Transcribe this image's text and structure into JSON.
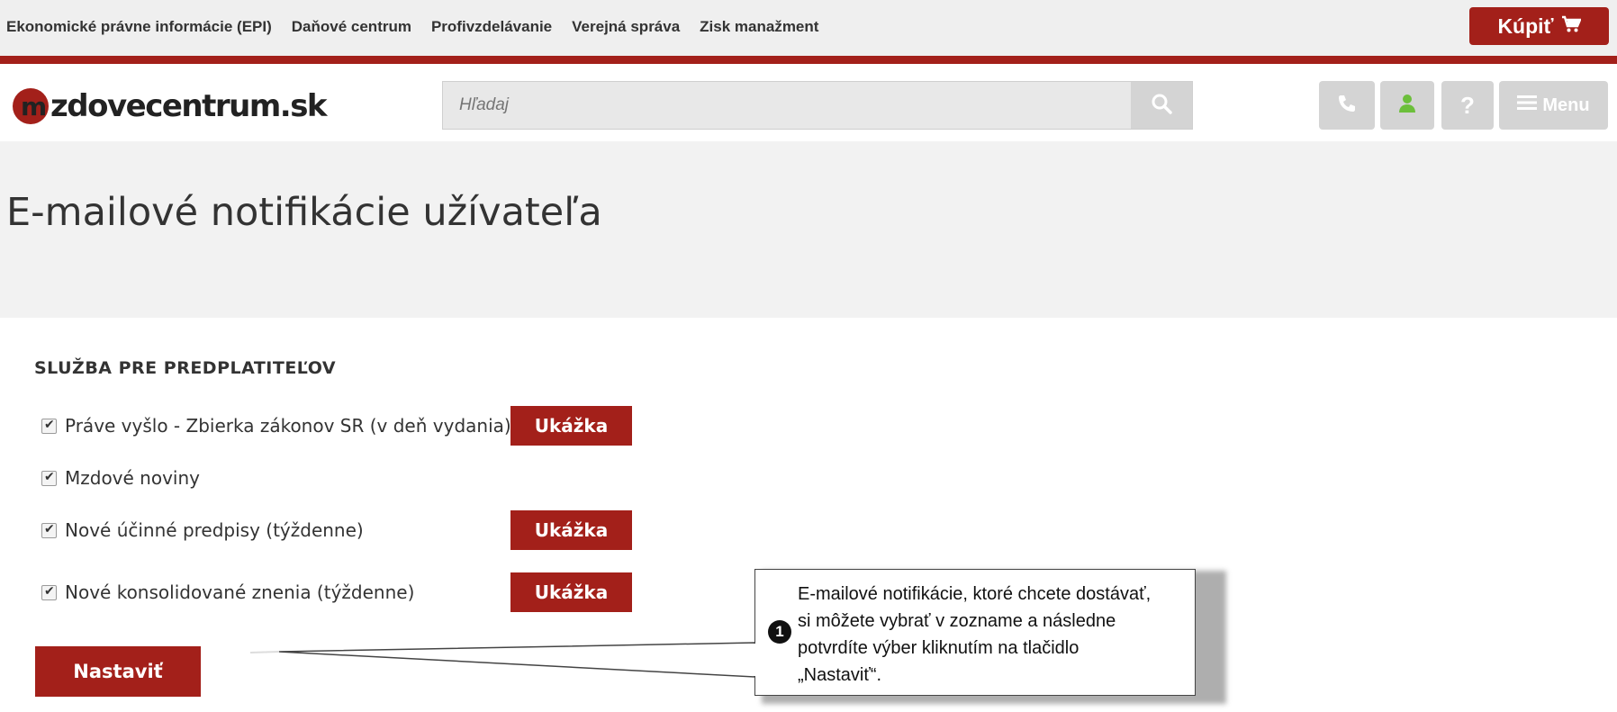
{
  "topnav": {
    "links": [
      "Ekonomické právne informácie (EPI)",
      "Daňové centrum",
      "Profivzdelávanie",
      "Verejná správa",
      "Zisk manažment"
    ],
    "buy_label": "Kúpiť",
    "accent_color": "#a3201a"
  },
  "header": {
    "logo_letter": "m",
    "logo_text": "zdovecentrum.sk",
    "search_placeholder": "Hľadaj",
    "menu_label": "Menu",
    "icons": [
      "phone-icon",
      "user-icon",
      "help-icon",
      "hamburger-icon"
    ]
  },
  "page": {
    "title": "E-mailové notifikácie užívateľa"
  },
  "subscriptions": {
    "heading": "SLUŽBA PRE PREDPLATITEĽOV",
    "options": [
      {
        "label": "Práve vyšlo - Zbierka zákonov SR (v deň vydania)",
        "checked": true,
        "preview": "Ukážka"
      },
      {
        "label": "Mzdové noviny",
        "checked": true,
        "preview": ""
      },
      {
        "label": "Nové účinné predpisy (týždenne)",
        "checked": true,
        "preview": "Ukážka"
      },
      {
        "label": "Nové konsolidované znenia (týždenne)",
        "checked": true,
        "preview": "Ukážka"
      }
    ],
    "submit_label": "Nastaviť"
  },
  "callout": {
    "number": "1",
    "text": "E-mailové notifikácie, ktoré chcete dostávať, si môžete vybrať v zozname a následne potvrdíte výber kliknutím na tlačidlo „Nastaviť“."
  }
}
